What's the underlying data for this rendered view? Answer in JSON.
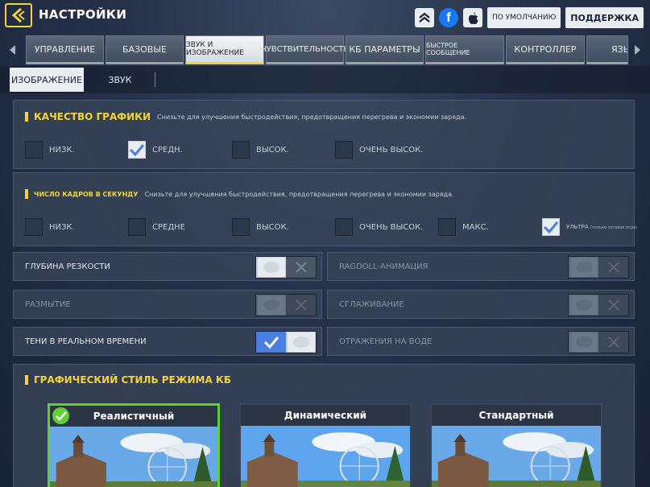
{
  "header": {
    "title": "НАСТРОЙКИ",
    "default_btn": "ПО УМОЛЧАНИЮ",
    "support_btn": "ПОДДЕРЖКА"
  },
  "tabs": [
    {
      "label": "УПРАВЛЕНИЕ"
    },
    {
      "label": "БАЗОВЫЕ"
    },
    {
      "label": "ЗВУК И ИЗОБРАЖЕНИЕ"
    },
    {
      "label": "ЧУВСТВИТЕЛЬНОСТЬ"
    },
    {
      "label": "КБ ПАРАМЕТРЫ"
    },
    {
      "label": "БЫСТРОЕ СООБЩЕНИЕ"
    },
    {
      "label": "КОНТРОЛЛЕР"
    },
    {
      "label": "ЯЗЫ"
    }
  ],
  "subtabs": [
    {
      "label": "ИЗОБРАЖЕНИЕ"
    },
    {
      "label": "ЗВУК"
    }
  ],
  "graphics_quality": {
    "title": "КАЧЕСТВО ГРАФИКИ",
    "description": "Снизьте для улучшения быстродействия, предотвращения перегрева и экономии заряда.",
    "options": [
      {
        "label": "НИЗК."
      },
      {
        "label": "СРЕДН."
      },
      {
        "label": "ВЫСОК."
      },
      {
        "label": "ОЧЕНЬ ВЫСОК."
      }
    ],
    "selected": "СРЕДН."
  },
  "frame_rate": {
    "title": "ЧИСЛО КАДРОВ В СЕКУНДУ",
    "description": "Снизьте для улучшения быстродействия, предотвращения перегрева и экономии заряда.",
    "options": [
      {
        "label": "НИЗК."
      },
      {
        "label": "СРЕДНЕ"
      },
      {
        "label": "ВЫСОК."
      },
      {
        "label": "ОЧЕНЬ ВЫСОК."
      },
      {
        "label": "МАКС."
      },
      {
        "label": "УЛЬТРА",
        "note": "(только сетевая игра)"
      }
    ],
    "selected": "УЛЬТРА"
  },
  "toggles": [
    {
      "label": "ГЛУБИНА РЕЗКОСТИ",
      "state": "off",
      "enabled": true
    },
    {
      "label": "RAGDOLL-АНИМАЦИЯ",
      "state": "off",
      "enabled": false
    },
    {
      "label": "РАЗМЫТИЕ",
      "state": "off",
      "enabled": false
    },
    {
      "label": "СГЛАЖИВАНИЕ",
      "state": "off",
      "enabled": false
    },
    {
      "label": "ТЕНИ В РЕАЛЬНОМ ВРЕМЕНИ",
      "state": "on",
      "enabled": true
    },
    {
      "label": "ОТРАЖЕНИЯ НА ВОДЕ",
      "state": "off",
      "enabled": false
    }
  ],
  "br_style": {
    "title": "ГРАФИЧЕСКИЙ СТИЛЬ РЕЖИМА КБ",
    "cards": [
      {
        "label": "Реалистичный"
      },
      {
        "label": "Динамический"
      },
      {
        "label": "Стандартный"
      }
    ],
    "selected": "Реалистичный"
  },
  "colors": {
    "accent_yellow": "#f2d43a",
    "selected_green": "#5fd136",
    "toggle_on_blue": "#4a7fe0"
  }
}
